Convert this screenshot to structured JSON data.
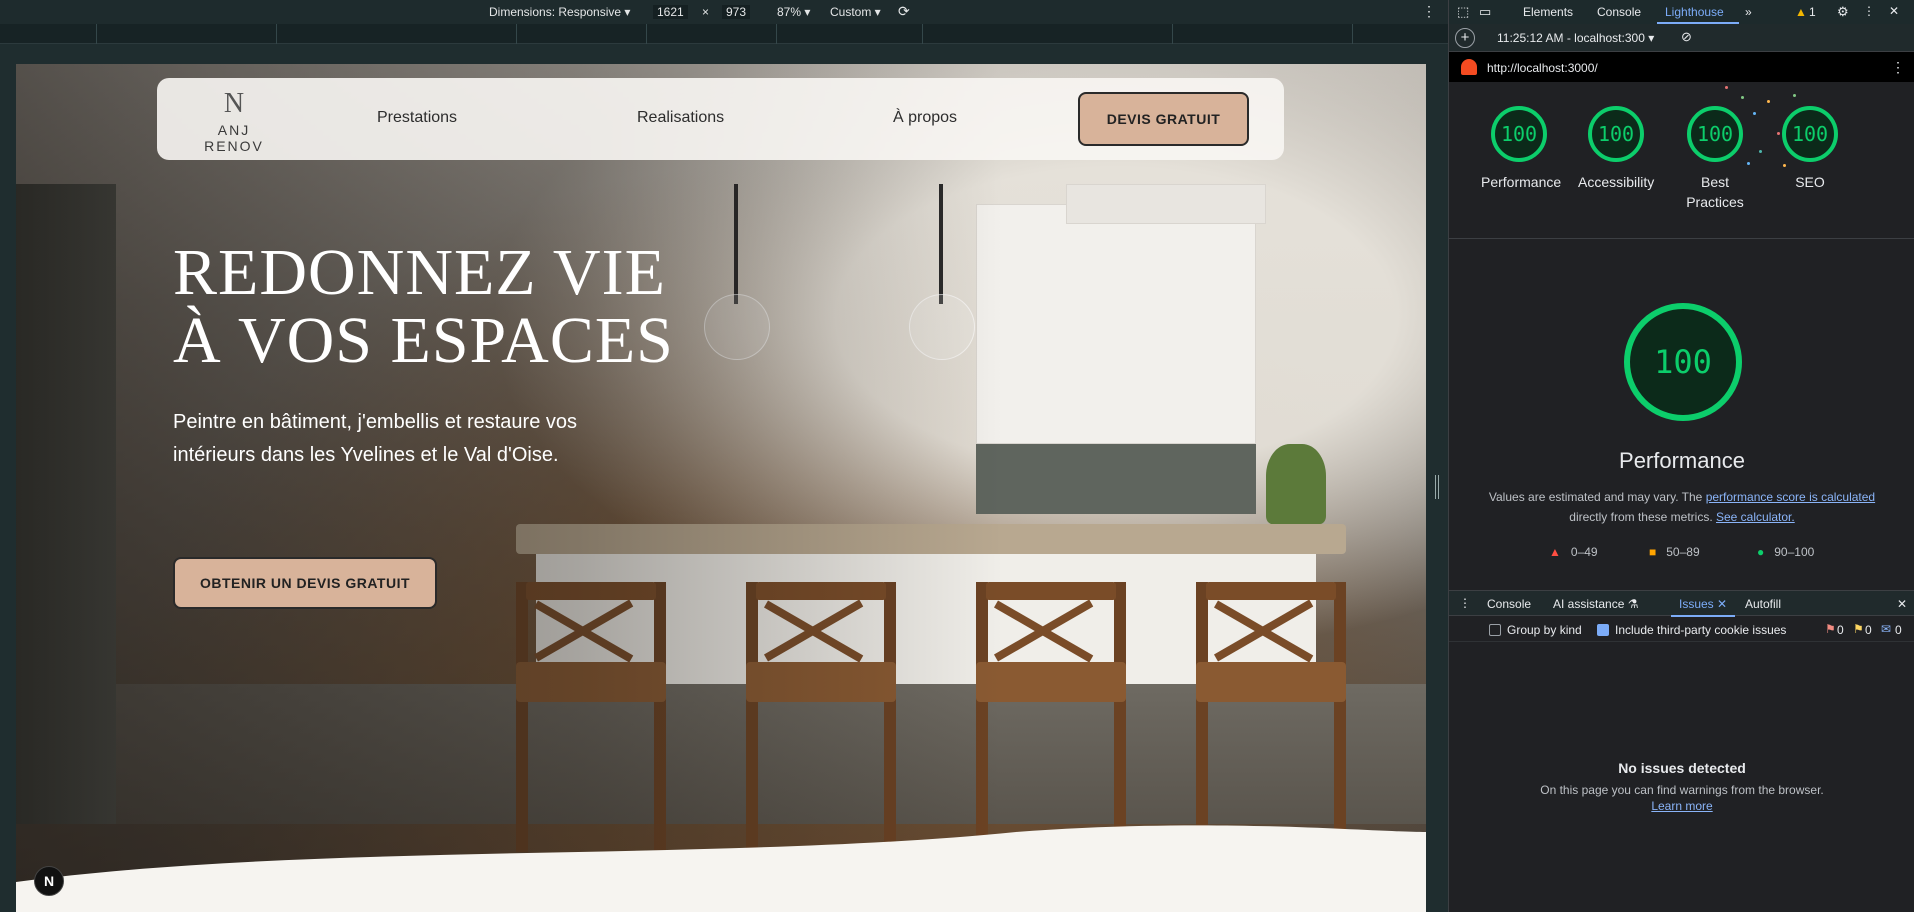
{
  "device_toolbar": {
    "dimensions_label": "Dimensions: Responsive",
    "width": "1621",
    "times": "×",
    "height": "973",
    "zoom": "87%",
    "throttle": "Custom"
  },
  "site": {
    "logo_mark": "N",
    "logo_text": "ANJ RENOV",
    "nav": [
      "Prestations",
      "Realisations",
      "À propos"
    ],
    "nav_cta": "DEVIS GRATUIT",
    "hero_title_line1": "REDONNEZ VIE",
    "hero_title_line2": "À VOS ESPACES",
    "hero_subtitle": "Peintre en bâtiment, j'embellis et restaure vos intérieurs dans les Yvelines et le Val d'Oise.",
    "hero_cta": "OBTENIR UN DEVIS GRATUIT",
    "badge": "N"
  },
  "devtools": {
    "tabs": [
      "Elements",
      "Console",
      "Lighthouse"
    ],
    "active_tab": "Lighthouse",
    "warning_count": "1",
    "run_label": "11:25:12 AM - localhost:300",
    "url": "http://localhost:3000/",
    "scores": [
      {
        "label": "Performance",
        "value": "100"
      },
      {
        "label": "Accessibility",
        "value": "100"
      },
      {
        "label": "Best Practices",
        "value": "100"
      },
      {
        "label": "SEO",
        "value": "100"
      }
    ],
    "main_score": "100",
    "main_title": "Performance",
    "note_prefix": "Values are estimated and may vary. The",
    "note_link1": "performance score is calculated",
    "note_middle": "directly from these metrics.",
    "note_link2": "See calculator.",
    "legend": [
      {
        "range": "0–49",
        "color": "#ff4e42"
      },
      {
        "range": "50–89",
        "color": "#ffa400"
      },
      {
        "range": "90–100",
        "color": "#0cce6b"
      }
    ],
    "drawer_tabs": [
      "Console",
      "AI assistance",
      "Issues",
      "Autofill"
    ],
    "active_drawer_tab": "Issues",
    "group_by_kind": "Group by kind",
    "include_third_party": "Include third-party cookie issues",
    "issue_counts": [
      "0",
      "0",
      "0"
    ],
    "no_issues_title": "No issues detected",
    "no_issues_text": "On this page you can find warnings from the browser.",
    "learn_more": "Learn more"
  },
  "colors": {
    "score_green": "#0cce6b",
    "cta_bg": "#d8b39a",
    "devtools_accent": "#7cacf8"
  }
}
